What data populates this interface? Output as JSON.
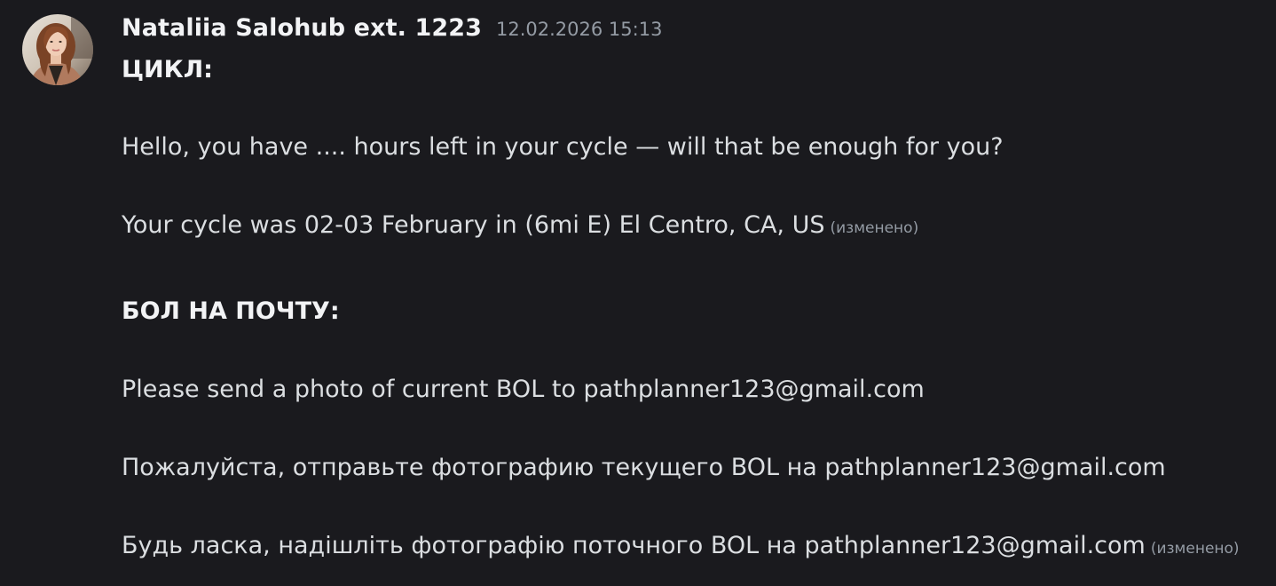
{
  "message": {
    "author": "Nataliia Salohub ext. 1223",
    "timestamp": "12.02.2026 15:13",
    "avatar_icon": "user-avatar-photo",
    "lines": {
      "heading_cycle": "ЦИКЛ:",
      "cycle_question": "Hello, you have .... hours left in your cycle — will that be enough for you?",
      "cycle_info": "Your cycle was 02-03 February in (6mi E) El Centro, CA, US",
      "heading_bol": "БОЛ НА ПОЧТУ:",
      "bol_en": "Please send a photo of current BOL to pathplanner123@gmail.com",
      "bol_ru": "Пожалуйста, отправьте фотографию текущего BOL на pathplanner123@gmail.com",
      "bol_uk": "Будь ласка, надішліть фотографію поточного BOL на pathplanner123@gmail.com"
    },
    "edited_label": "(изменено)"
  },
  "colors": {
    "background": "#1a1a1e",
    "text": "#dbdee1",
    "username": "#f2f3f5",
    "muted": "#949ba4"
  }
}
